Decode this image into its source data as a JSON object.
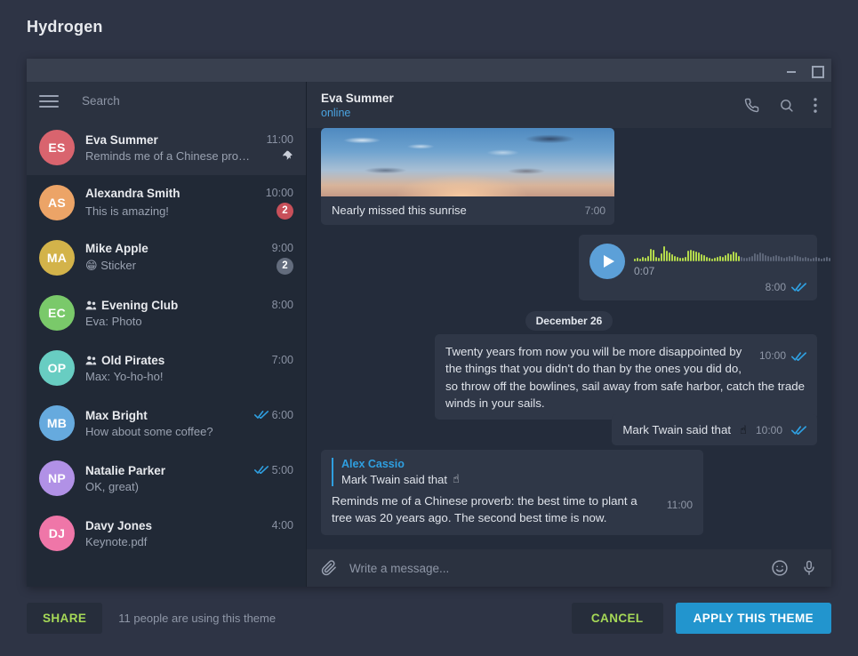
{
  "theme_name": "Hydrogen",
  "titlebar": {
    "minimize": "minimize-button",
    "maximize": "maximize-button"
  },
  "search": {
    "placeholder": "Search",
    "value": ""
  },
  "chats": [
    {
      "initials": "ES",
      "color": "#d9646e",
      "name": "Eva Summer",
      "time": "11:00",
      "preview": "Reminds me of a Chinese pro…",
      "sender": "",
      "emoji": "",
      "badge": "",
      "badge_type": "",
      "pinned": true,
      "group": false,
      "read": false,
      "active": true
    },
    {
      "initials": "AS",
      "color": "#eca467",
      "name": "Alexandra Smith",
      "time": "10:00",
      "preview": "This is amazing!",
      "sender": "",
      "emoji": "",
      "badge": "2",
      "badge_type": "unread",
      "pinned": false,
      "group": false,
      "read": false,
      "active": false
    },
    {
      "initials": "MA",
      "color": "#d3b34a",
      "name": "Mike Apple",
      "time": "9:00",
      "preview": "Sticker",
      "sender": "",
      "emoji": "😁",
      "badge": "2",
      "badge_type": "muted",
      "pinned": false,
      "group": false,
      "read": false,
      "active": false
    },
    {
      "initials": "EC",
      "color": "#7ac96a",
      "name": "Evening Club",
      "time": "8:00",
      "preview": "Photo",
      "sender": "Eva: ",
      "emoji": "",
      "badge": "",
      "badge_type": "",
      "pinned": false,
      "group": true,
      "read": false,
      "active": false
    },
    {
      "initials": "OP",
      "color": "#68cdc2",
      "name": "Old Pirates",
      "time": "7:00",
      "preview": "Yo-ho-ho!",
      "sender": "Max: ",
      "emoji": "",
      "badge": "",
      "badge_type": "",
      "pinned": false,
      "group": true,
      "read": false,
      "active": false
    },
    {
      "initials": "MB",
      "color": "#66aade",
      "name": "Max Bright",
      "time": "6:00",
      "preview": "How about some coffee?",
      "sender": "",
      "emoji": "",
      "badge": "",
      "badge_type": "",
      "pinned": false,
      "group": false,
      "read": true,
      "active": false
    },
    {
      "initials": "NP",
      "color": "#b191e6",
      "name": "Natalie Parker",
      "time": "5:00",
      "preview": "OK, great)",
      "sender": "",
      "emoji": "",
      "badge": "",
      "badge_type": "",
      "pinned": false,
      "group": false,
      "read": true,
      "active": false
    },
    {
      "initials": "DJ",
      "color": "#ef76a8",
      "name": "Davy Jones",
      "time": "4:00",
      "preview": "Keynote.pdf",
      "sender": "",
      "emoji": "",
      "badge": "",
      "badge_type": "",
      "pinned": false,
      "group": false,
      "read": false,
      "active": false
    }
  ],
  "chat_header": {
    "title": "Eva Summer",
    "status": "online",
    "call_icon": "phone-icon",
    "search_icon": "search-icon",
    "menu_icon": "more-vertical-icon"
  },
  "messages": {
    "photo": {
      "caption": "Nearly missed this sunrise",
      "time": "7:00"
    },
    "voice": {
      "duration": "0:07",
      "time": "8:00",
      "read": true
    },
    "date_divider": "December 26",
    "quote": {
      "text": "Twenty years from now you will be more disappointed by the things that you didn't do than by the ones you did do, so throw off the bowlines, sail away from safe harbor, catch the trade winds in your sails.",
      "time": "10:00",
      "read": true
    },
    "short": {
      "text": "Mark Twain said that",
      "emoji": "☝",
      "time": "10:00",
      "read": true
    },
    "reply": {
      "author": "Alex Cassio",
      "quoted": "Mark Twain said that",
      "quoted_emoji": "☝",
      "text": "Reminds me of a Chinese proverb: the best time to plant a tree was 20 years ago. The second best time is now.",
      "time": "11:00"
    }
  },
  "composer": {
    "attach_icon": "paperclip-icon",
    "placeholder": "Write a message...",
    "value": "",
    "emoji_icon": "smiley-icon",
    "mic_icon": "microphone-icon"
  },
  "bottom_bar": {
    "share_label": "SHARE",
    "usage_text": "11 people are using this theme",
    "cancel_label": "CANCEL",
    "apply_label": "APPLY THIS THEME"
  },
  "colors": {
    "accent_blue": "#2295ce",
    "accent_green": "#a6d957",
    "link_blue": "#2f9fe0",
    "tick_blue": "#2f9fe0",
    "waveform_played": "#b3d94c",
    "waveform_unplayed": "#5d6678",
    "badge_unread": "#c8505a",
    "badge_muted": "#636c7d",
    "page_bg": "#2e3445",
    "window_bg": "#212936",
    "panel_bg": "#2b3240",
    "bubble_bg": "#2f3747",
    "chat_bg": "#242c3b"
  },
  "waveform": {
    "played_count": 40,
    "heights": [
      3,
      4,
      3,
      5,
      4,
      6,
      14,
      13,
      5,
      4,
      9,
      17,
      12,
      10,
      8,
      6,
      5,
      4,
      4,
      5,
      12,
      13,
      12,
      11,
      10,
      8,
      7,
      5,
      4,
      3,
      4,
      5,
      6,
      5,
      7,
      9,
      8,
      11,
      10,
      6,
      5,
      4,
      4,
      5,
      6,
      9,
      8,
      10,
      9,
      7,
      6,
      5,
      6,
      7,
      6,
      5,
      4,
      5,
      6,
      5,
      7,
      6,
      5,
      4,
      5,
      4,
      3,
      4,
      5,
      4,
      3,
      4,
      5,
      4,
      3,
      3,
      4,
      3,
      3,
      2
    ]
  }
}
